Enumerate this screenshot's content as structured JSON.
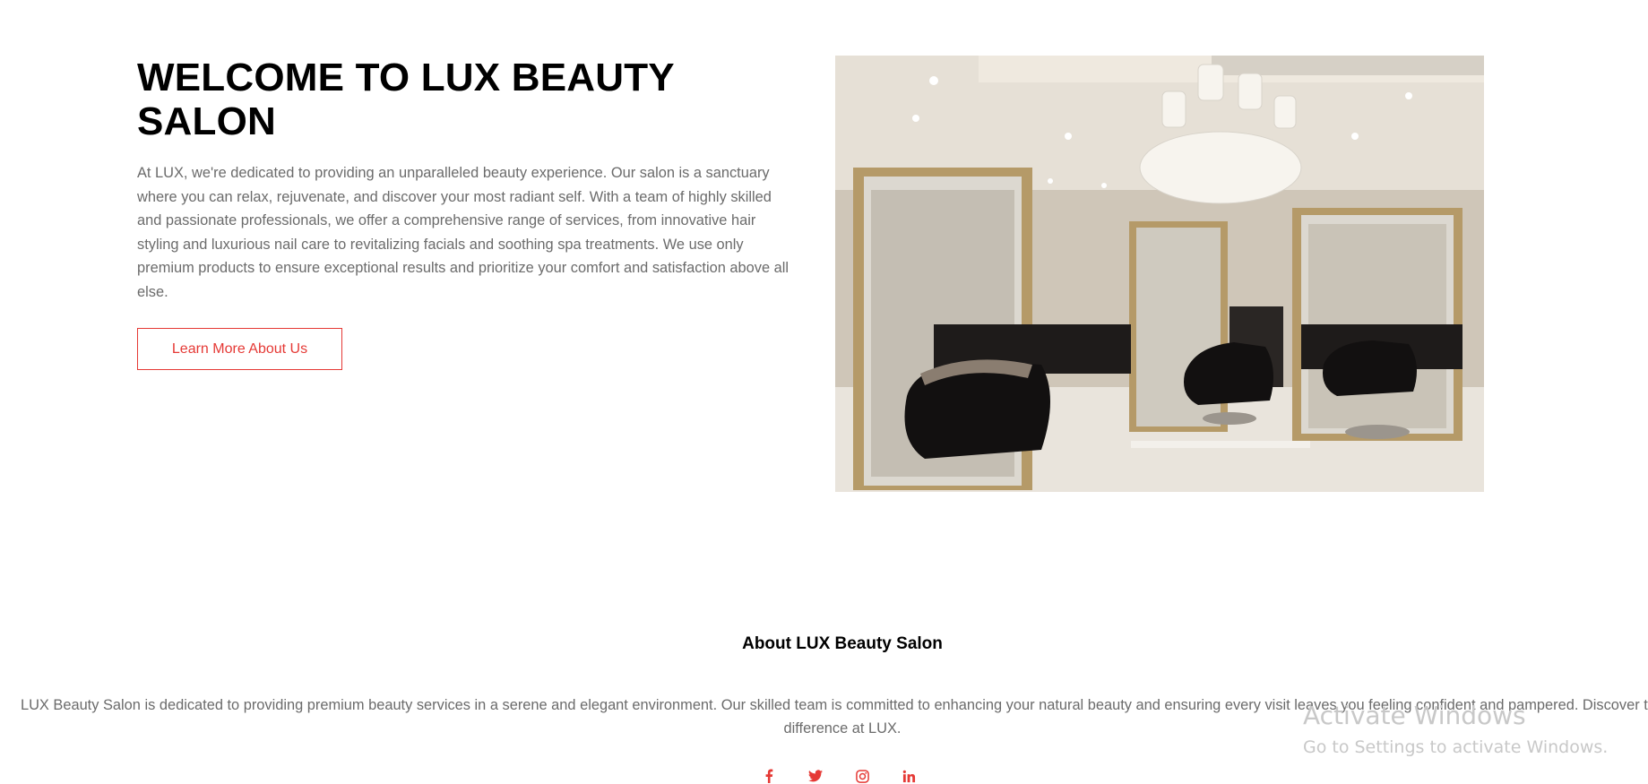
{
  "hero": {
    "title": "WELCOME TO LUX BEAUTY SALON",
    "body": "At LUX, we're dedicated to providing an unparalleled beauty experience. Our salon is a sanctuary where you can relax, rejuvenate, and discover your most radiant self. With a team of highly skilled and passionate professionals, we offer a comprehensive range of services, from innovative hair styling and luxurious nail care to revitalizing facials and soothing spa treatments. We use only premium products to ensure exceptional results and prioritize your comfort and satisfaction above all else.",
    "button_label": "Learn More About Us"
  },
  "about": {
    "title": "About LUX Beauty Salon",
    "text": "LUX Beauty Salon is dedicated to providing premium beauty services in a serene and elegant environment. Our skilled team is committed to enhancing your natural beauty and ensuring every visit leaves you feeling confident and pampered. Discover the difference at LUX."
  },
  "social": [
    "facebook-icon",
    "twitter-icon",
    "instagram-icon",
    "linkedin-icon"
  ],
  "watermark": {
    "title": "Activate Windows",
    "subtitle": "Go to Settings to activate Windows."
  },
  "colors": {
    "accent": "#e53935",
    "heading": "#000000",
    "body_text": "#6b6b6b"
  }
}
